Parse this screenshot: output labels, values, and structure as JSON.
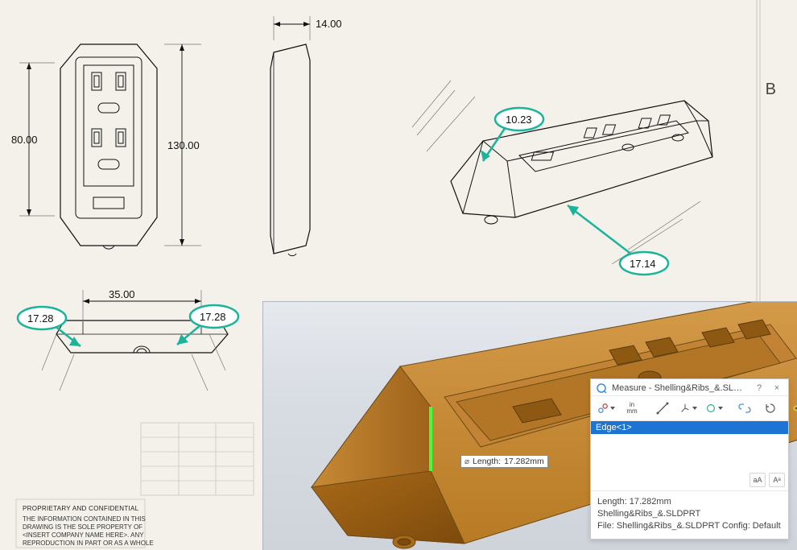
{
  "domain": "Computer-Use",
  "drawing": {
    "zone_letter": "B",
    "dimensions": {
      "front_h": "80.00",
      "overall_h": "130.00",
      "top_w": "14.00",
      "bottom_w": "35.00",
      "chamfer_left": "17.28",
      "chamfer_right": "17.28",
      "iso_top": "10.23",
      "iso_bottom": "17.14"
    },
    "title_block": {
      "head": "PROPRIETARY AND CONFIDENTIAL",
      "line1": "THE INFORMATION CONTAINED IN THIS",
      "line2": "DRAWING IS THE SOLE PROPERTY OF",
      "line3": "<INSERT COMPANY NAME HERE>. ANY",
      "line4": "REPRODUCTION IN PART OR AS A WHOLE"
    }
  },
  "render": {
    "measure_callout_label": "Length:",
    "measure_callout_value": "17.282mm"
  },
  "measure_window": {
    "title": "Measure - Shelling&Ribs_&.SLDPRT",
    "help_btn": "?",
    "close_btn": "×",
    "toolbar": {
      "units_label": "in\nmm",
      "point_to_point": "point-to-point-icon",
      "xyz": "xyz-icon",
      "arc": "arc-icon",
      "link": "link-icon",
      "history": "history-icon",
      "sensor": "sensor-icon"
    },
    "selection": "Edge<1>",
    "results": {
      "length_label": "Length:",
      "length_value": "17.282mm",
      "file_label": "",
      "file_value": "Shelling&Ribs_&.SLDPRT",
      "config_label": "File:",
      "config_value": "Shelling&Ribs_&.SLDPRT Config: Default"
    },
    "corner_btn1": "aA",
    "corner_btn2": "Aᵃ"
  }
}
